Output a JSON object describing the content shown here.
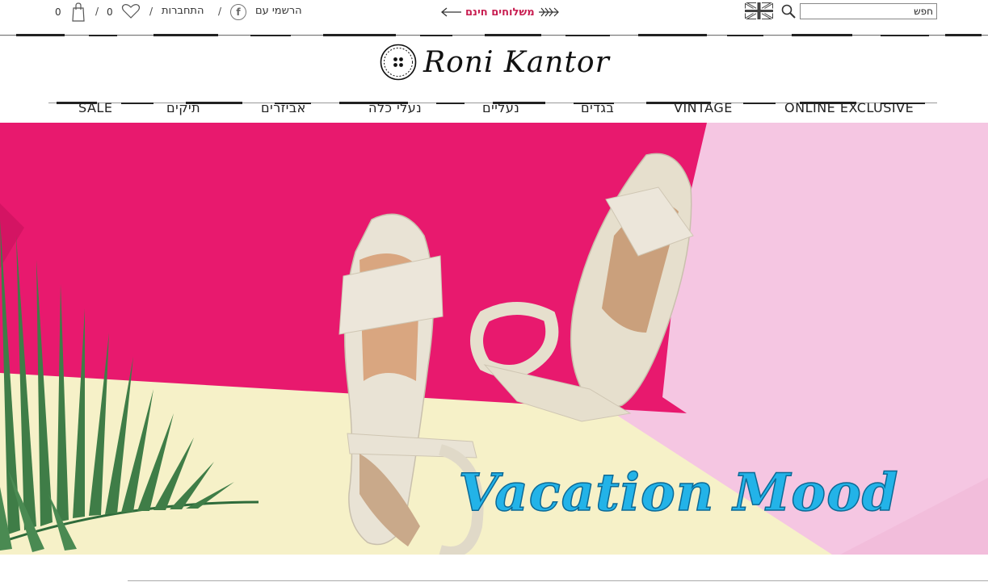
{
  "topbar": {
    "cart_count": "0",
    "wishlist_count": "0",
    "separator": "/",
    "login_label": "התחברות",
    "signup_label": "הרשמי עם",
    "free_shipping": "משלוחים חינם",
    "search_placeholder": "חפש"
  },
  "logo": {
    "text": "Roni Kantor"
  },
  "nav": {
    "items": [
      "ONLINE EXCLUSIVE",
      "VINTAGE",
      "בגדים",
      "נעליים",
      "נעלי כלה",
      "אביזרים",
      "תיקים",
      "SALE"
    ]
  },
  "hero": {
    "headline": "Vacation Mood",
    "colors": {
      "magenta": "#e8196e",
      "cream": "#f6f1c8",
      "pink": "#f5c6e2",
      "headline": "#23b3e8",
      "accent": "#c81e51"
    }
  },
  "icons": {
    "cart": "shopping-bag-icon",
    "wishlist": "heart-icon",
    "facebook": "facebook-icon",
    "flag": "uk-flag-icon",
    "search": "search-icon",
    "shipping_arrow": "arrow-left-icon"
  }
}
